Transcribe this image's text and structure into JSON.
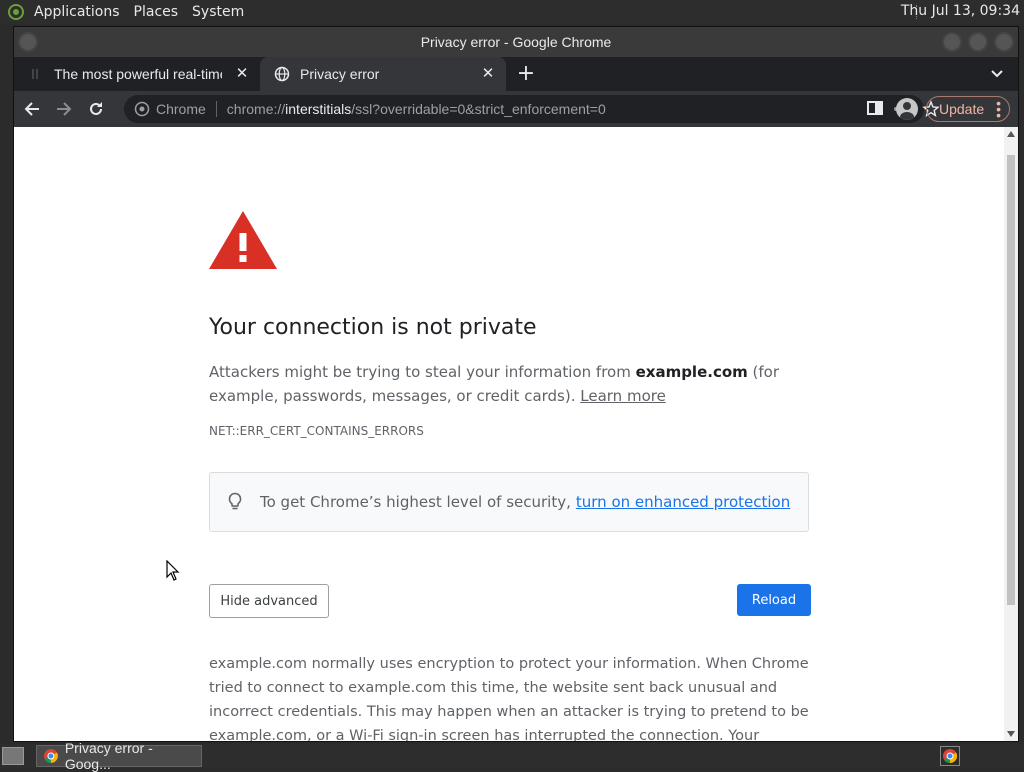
{
  "top_panel": {
    "menus": [
      "Applications",
      "Places",
      "System"
    ],
    "clock": "Thu Jul 13, 09:34"
  },
  "window": {
    "title": "Privacy error - Google Chrome"
  },
  "tabs": [
    {
      "label": "The most powerful real-time",
      "icon": "tab-favicon",
      "active": false
    },
    {
      "label": "Privacy error",
      "icon": "globe-icon",
      "active": true
    }
  ],
  "toolbar": {
    "omnibox_chip": "Chrome",
    "url_prefix": "chrome://",
    "url_host": "interstitials",
    "url_path": "/ssl?overridable=0&strict_enforcement=0",
    "update_label": "Update"
  },
  "page": {
    "heading": "Your connection is not private",
    "explain_before": "Attackers might be trying to steal your information from ",
    "explain_host": "example.com",
    "explain_after": " (for example, passwords, messages, or credit cards). ",
    "learn_more": "Learn more",
    "error_code": "NET::ERR_CERT_CONTAINS_ERRORS",
    "enhanced_text": "To get Chrome’s highest level of security,",
    "enhanced_link": "turn on enhanced protection",
    "hide_advanced": "Hide advanced",
    "reload": "Reload",
    "details": "example.com normally uses encryption to protect your information. When Chrome tried to connect to example.com this time, the website sent back unusual and incorrect credentials. This may happen when an attacker is trying to pretend to be example.com, or a Wi-Fi sign-in screen has interrupted the connection. Your information is still secure"
  },
  "taskbar": {
    "task_label": "Privacy error - Goog..."
  },
  "colors": {
    "warning_red": "#d93025",
    "link_blue": "#1a73e8",
    "button_blue": "#1a73e8",
    "update_accent": "#f0b6a6"
  }
}
